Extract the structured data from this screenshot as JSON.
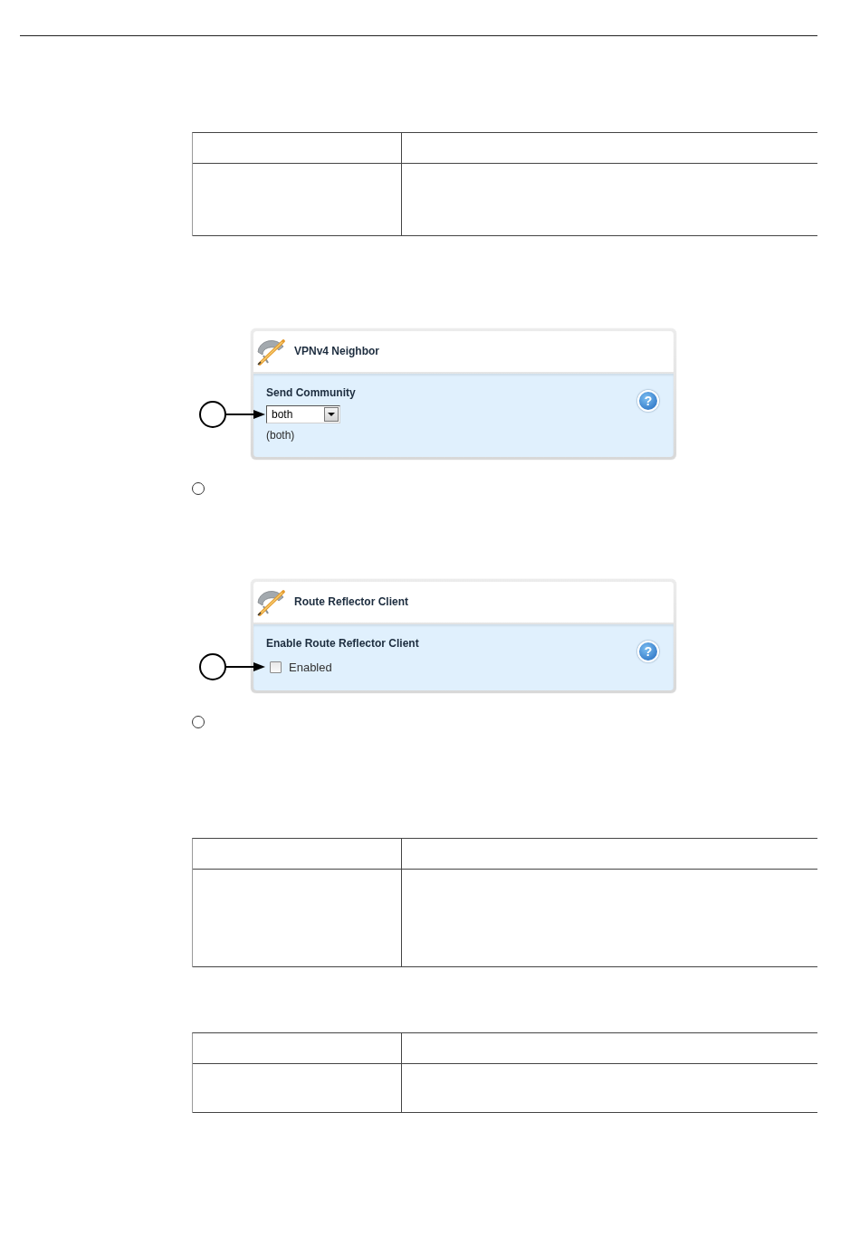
{
  "blocks": [
    {
      "kind": "table"
    },
    {
      "kind": "panel",
      "title": "VPNv4 Neighbor",
      "field": {
        "kind": "dropdown",
        "label": "Send Community",
        "value": "both",
        "hint": "(both)"
      },
      "help": "?"
    },
    {
      "kind": "marker"
    },
    {
      "kind": "panel",
      "title": "Route Reflector Client",
      "field": {
        "kind": "checkbox",
        "label": "Enable Route Reflector Client",
        "option": "Enabled",
        "checked": false
      },
      "help": "?"
    },
    {
      "kind": "marker"
    },
    {
      "kind": "table"
    },
    {
      "kind": "table"
    }
  ]
}
